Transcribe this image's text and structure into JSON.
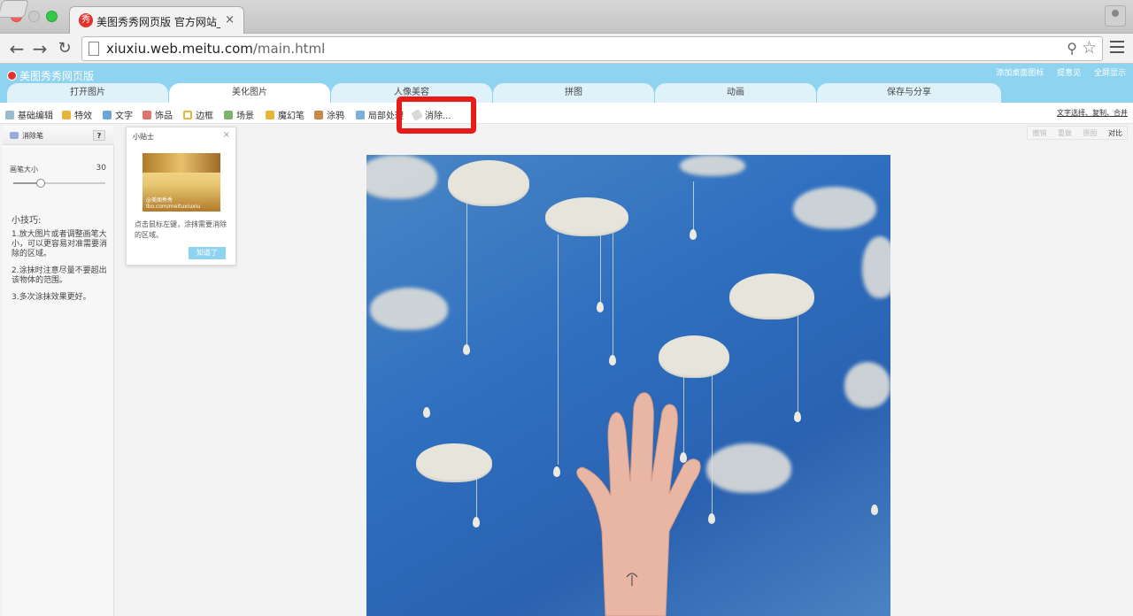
{
  "browser": {
    "tab_title": "美图秀秀网页版 官方网站_在",
    "tab_close": "×",
    "url_host": "xiuxiu.web.meitu.com",
    "url_path": "/main.html",
    "favicon_text": "秀"
  },
  "app": {
    "logo_text": "美图秀秀网页版",
    "top_links": [
      "添加桌面图标",
      "提意见",
      "全屏显示"
    ]
  },
  "main_tabs": [
    "打开图片",
    "美化图片",
    "人像美容",
    "拼图",
    "动画",
    "保存与分享"
  ],
  "toolbar": {
    "items": [
      "基础编辑",
      "特效",
      "文字",
      "饰品",
      "边框",
      "场景",
      "魔幻笔",
      "涂鸦",
      "局部处理",
      "消除..."
    ],
    "right_link": "文字选择、复制、合并"
  },
  "left_panel": {
    "title": "消除笔",
    "help": "?",
    "brush_label": "画笔大小",
    "brush_value": "30",
    "brush_fraction": 0.3,
    "tips_title": "小技巧:",
    "tips": [
      "1.放大图片或者调整画笔大小，可以更容易对准需要消除的区域。",
      "2.涂抹时注意尽量不要超出该物体的范围。",
      "3.多次涂抹效果更好。"
    ]
  },
  "tip_card": {
    "title": "小贴士",
    "close": "×",
    "image_watermark": "@美图秀秀 lbo.com/meituxiuxiu",
    "text": "点击鼠标左键，涂抹需要消除的区域。",
    "ok": "知道了"
  },
  "edit_bar": [
    "撤销",
    "重做",
    "原图",
    "对比"
  ],
  "colors": {
    "accent": "#8ed3ef",
    "highlight": "#e81a1a",
    "photo_bg": "#2f6fbf"
  }
}
